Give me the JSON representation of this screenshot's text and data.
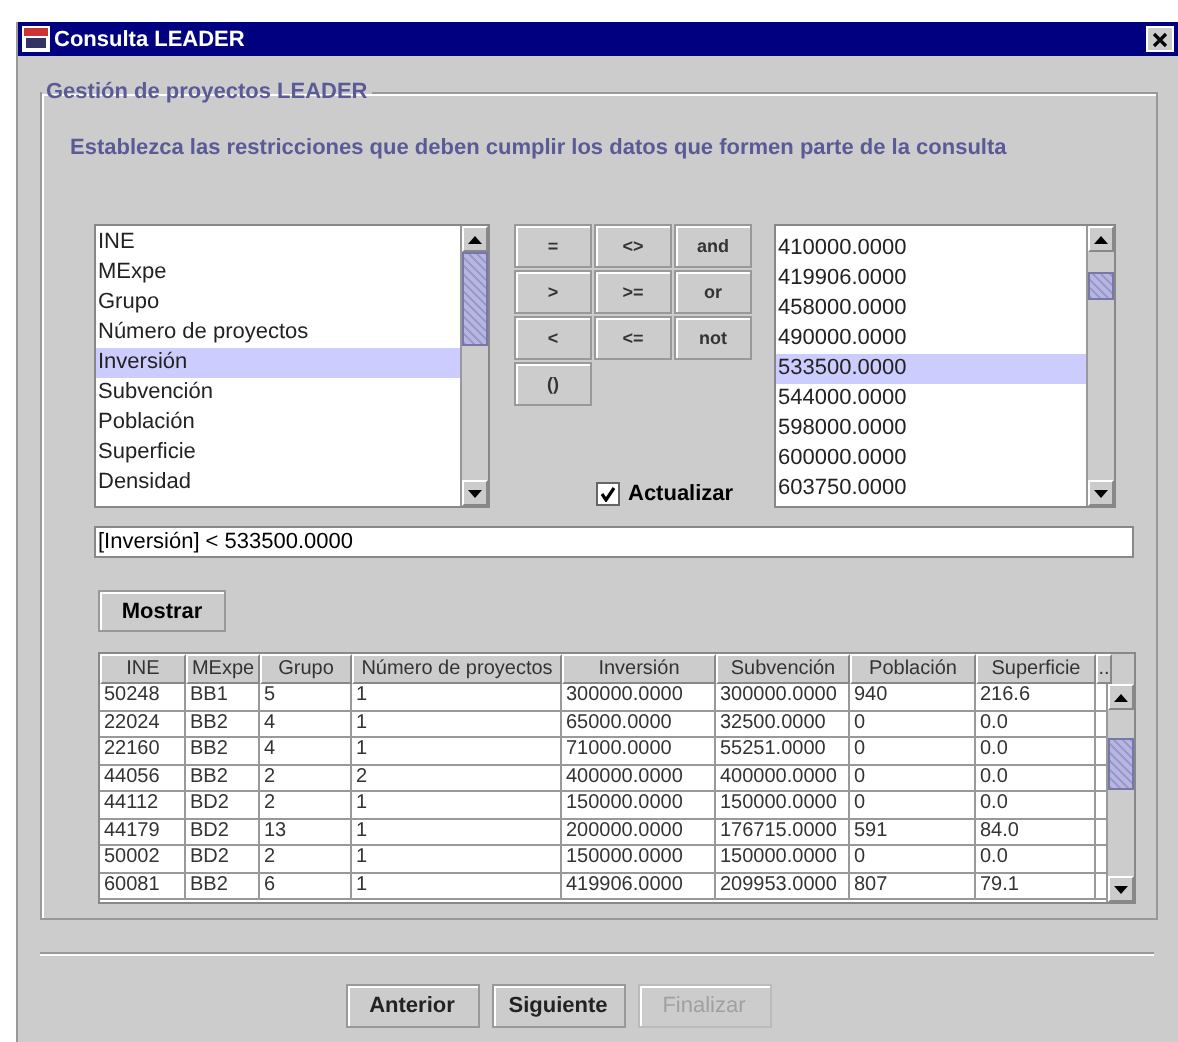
{
  "window": {
    "title": "Consulta LEADER"
  },
  "group_title": "Gestión de proyectos LEADER",
  "instruction": "Establezca las restricciones que deben cumplir los datos que formen parte de la consulta",
  "fields": [
    {
      "label": "INE",
      "selected": false
    },
    {
      "label": "MExpe",
      "selected": false
    },
    {
      "label": "Grupo",
      "selected": false
    },
    {
      "label": "Número de proyectos",
      "selected": false
    },
    {
      "label": "Inversión",
      "selected": true
    },
    {
      "label": "Subvención",
      "selected": false
    },
    {
      "label": "Población",
      "selected": false
    },
    {
      "label": "Superficie",
      "selected": false
    },
    {
      "label": "Densidad",
      "selected": false
    }
  ],
  "operators": [
    "=",
    "<>",
    "and",
    ">",
    ">=",
    "or",
    "<",
    "<=",
    "not",
    "()"
  ],
  "values": [
    {
      "label": "410000.0000",
      "selected": false
    },
    {
      "label": "419906.0000",
      "selected": false
    },
    {
      "label": "458000.0000",
      "selected": false
    },
    {
      "label": "490000.0000",
      "selected": false
    },
    {
      "label": "533500.0000",
      "selected": true
    },
    {
      "label": "544000.0000",
      "selected": false
    },
    {
      "label": "598000.0000",
      "selected": false
    },
    {
      "label": "600000.0000",
      "selected": false
    },
    {
      "label": "603750.0000",
      "selected": false
    }
  ],
  "update": {
    "label": "Actualizar",
    "checked": true
  },
  "expression": "[Inversión] < 533500.0000",
  "show_button": "Mostrar",
  "table": {
    "columns": [
      "INE",
      "MExpe",
      "Grupo",
      "Número de proyectos",
      "Inversión",
      "Subvención",
      "Población",
      "Superficie",
      ".."
    ],
    "rows": [
      [
        "50248",
        "BB1",
        "5",
        "1",
        "300000.0000",
        "300000.0000",
        "940",
        "216.6"
      ],
      [
        "22024",
        "BB2",
        "4",
        "1",
        "65000.0000",
        "32500.0000",
        "0",
        "0.0"
      ],
      [
        "22160",
        "BB2",
        "4",
        "1",
        "71000.0000",
        "55251.0000",
        "0",
        "0.0"
      ],
      [
        "44056",
        "BB2",
        "2",
        "2",
        "400000.0000",
        "400000.0000",
        "0",
        "0.0"
      ],
      [
        "44112",
        "BD2",
        "2",
        "1",
        "150000.0000",
        "150000.0000",
        "0",
        "0.0"
      ],
      [
        "44179",
        "BD2",
        "13",
        "1",
        "200000.0000",
        "176715.0000",
        "591",
        "84.0"
      ],
      [
        "50002",
        "BD2",
        "2",
        "1",
        "150000.0000",
        "150000.0000",
        "0",
        "0.0"
      ],
      [
        "60081",
        "BB2",
        "6",
        "1",
        "419906.0000",
        "209953.0000",
        "807",
        "79.1"
      ]
    ]
  },
  "buttons": [
    {
      "label": "Anterior",
      "disabled": false
    },
    {
      "label": "Siguiente",
      "disabled": false
    },
    {
      "label": "Finalizar",
      "disabled": true
    }
  ]
}
